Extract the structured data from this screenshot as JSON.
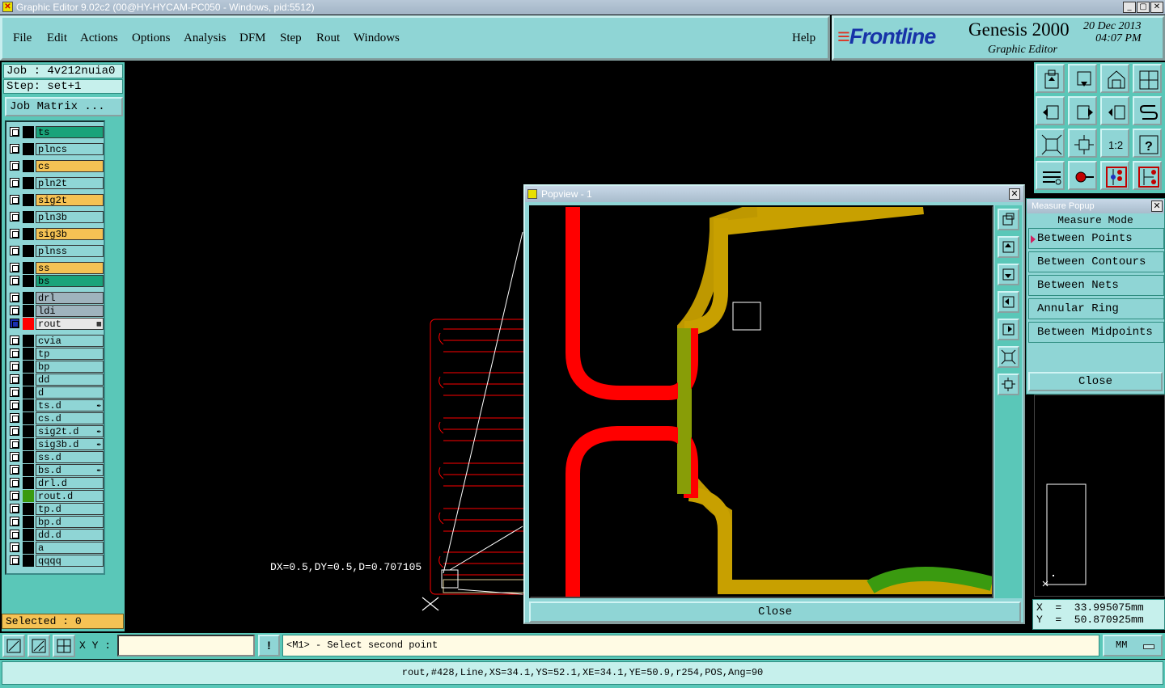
{
  "window": {
    "title": "Graphic Editor 9.02c2 (00@HY-HYCAM-PC050 - Windows, pid:5512)",
    "min": "_",
    "max": "▢",
    "close": "✕"
  },
  "menu": {
    "file": "File",
    "edit": "Edit",
    "actions": "Actions",
    "options": "Options",
    "analysis": "Analysis",
    "dfm": "DFM",
    "step": "Step",
    "rout": "Rout",
    "windows": "Windows",
    "help": "Help"
  },
  "brand": {
    "logo": "Frontline",
    "product": "Genesis 2000",
    "subtitle": "Graphic Editor",
    "date": "20 Dec 2013",
    "time": "04:07 PM"
  },
  "job": {
    "job": "Job : 4v212nuia0",
    "step": "Step: set+1",
    "matrix_button": "Job Matrix ..."
  },
  "layers": [
    {
      "name": "ts",
      "color": "#1aa37a",
      "swatch": "#000",
      "mark": ""
    },
    {
      "name": "plncs",
      "color": "#8fd5d5",
      "swatch": "#000",
      "mark": ""
    },
    {
      "name": "cs",
      "color": "#f5c254",
      "swatch": "#000",
      "mark": ""
    },
    {
      "name": "pln2t",
      "color": "#8fd5d5",
      "swatch": "#000",
      "mark": ""
    },
    {
      "name": "sig2t",
      "color": "#f5c254",
      "swatch": "#000",
      "mark": ""
    },
    {
      "name": "pln3b",
      "color": "#8fd5d5",
      "swatch": "#000",
      "mark": ""
    },
    {
      "name": "sig3b",
      "color": "#f5c254",
      "swatch": "#000",
      "mark": ""
    },
    {
      "name": "plnss",
      "color": "#8fd5d5",
      "swatch": "#000",
      "mark": ""
    },
    {
      "name": "ss",
      "color": "#f5c254",
      "swatch": "#000",
      "mark": ""
    },
    {
      "name": "bs",
      "color": "#1aa37a",
      "swatch": "#000",
      "mark": ""
    },
    {
      "name": "drl",
      "color": "#9fb3bd",
      "swatch": "#000",
      "mark": ""
    },
    {
      "name": "ldi",
      "color": "#9fb3bd",
      "swatch": "#000",
      "mark": ""
    },
    {
      "name": "rout",
      "color": "#e8e8e8",
      "swatch": "#ff0000",
      "mark": "▦"
    },
    {
      "name": "cvia",
      "color": "#8fd5d5",
      "swatch": "#000",
      "mark": ""
    },
    {
      "name": "tp",
      "color": "#8fd5d5",
      "swatch": "#000",
      "mark": ""
    },
    {
      "name": "bp",
      "color": "#8fd5d5",
      "swatch": "#000",
      "mark": ""
    },
    {
      "name": "dd",
      "color": "#8fd5d5",
      "swatch": "#000",
      "mark": ""
    },
    {
      "name": "d",
      "color": "#8fd5d5",
      "swatch": "#000",
      "mark": ""
    },
    {
      "name": "ts.d",
      "color": "#8fd5d5",
      "swatch": "#000",
      "mark": "✒"
    },
    {
      "name": "cs.d",
      "color": "#8fd5d5",
      "swatch": "#000",
      "mark": ""
    },
    {
      "name": "sig2t.d",
      "color": "#8fd5d5",
      "swatch": "#000",
      "mark": "✒"
    },
    {
      "name": "sig3b.d",
      "color": "#8fd5d5",
      "swatch": "#000",
      "mark": "✒"
    },
    {
      "name": "ss.d",
      "color": "#8fd5d5",
      "swatch": "#000",
      "mark": ""
    },
    {
      "name": "bs.d",
      "color": "#8fd5d5",
      "swatch": "#000",
      "mark": "✒"
    },
    {
      "name": "drl.d",
      "color": "#8fd5d5",
      "swatch": "#000",
      "mark": ""
    },
    {
      "name": "rout.d",
      "color": "#8fd5d5",
      "swatch": "#3a9a10",
      "mark": ""
    },
    {
      "name": "tp.d",
      "color": "#8fd5d5",
      "swatch": "#000",
      "mark": ""
    },
    {
      "name": "bp.d",
      "color": "#8fd5d5",
      "swatch": "#000",
      "mark": ""
    },
    {
      "name": "dd.d",
      "color": "#8fd5d5",
      "swatch": "#000",
      "mark": ""
    },
    {
      "name": "a",
      "color": "#8fd5d5",
      "swatch": "#000",
      "mark": ""
    },
    {
      "name": "qqqq",
      "color": "#8fd5d5",
      "swatch": "#000",
      "mark": ""
    }
  ],
  "selected": "Selected : 0",
  "canvas": {
    "measure_readout": "DX=0.5,DY=0.5,D=0.707105"
  },
  "popview": {
    "title": "Popview - 1",
    "close_x": "✕",
    "close_button": "Close"
  },
  "right_tools": [
    "open-icon",
    "save-icon",
    "home-icon",
    "step-profile-icon",
    "zoom-in-left-icon",
    "zoom-out-right-icon",
    "flip-icon",
    "snake-icon",
    "fit-icon",
    "center-icon",
    "ratio-icon",
    "help-icon",
    "tools-icon",
    "probe-icon",
    "drill-map-icon",
    "net-icon"
  ],
  "ratio_label": "1:2",
  "measure": {
    "title": "Measure Popup",
    "close_x": "✕",
    "header": "Measure Mode",
    "options": [
      "Between Points",
      "Between Contours",
      "Between Nets",
      "Annular Ring",
      "Between Midpoints"
    ],
    "close_button": "Close"
  },
  "coords": {
    "x": "X  =  33.995075mm",
    "y": "Y  =  50.870925mm"
  },
  "bottom": {
    "xy_label": "X Y :",
    "xy_value": "",
    "excl": "!",
    "prompt": "<M1> - Select second point",
    "units": "MM"
  },
  "status": "rout,#428,Line,XS=34.1,YS=52.1,XE=34.1,YE=50.9,r254,POS,Ang=90",
  "colors": {
    "panel": "#8fd5d5",
    "panel_dark": "#5ac7b8",
    "rout": "#ff0000",
    "tan": "#c8a000",
    "green": "#3a9a10"
  }
}
